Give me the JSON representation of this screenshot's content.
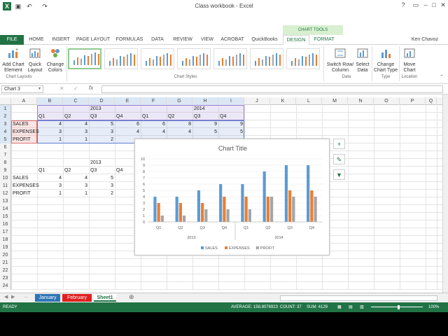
{
  "title_bar": {
    "title": "Class workbook - Excel",
    "chart_tools_label": "CHART TOOLS",
    "qat_icons": [
      "excel-icon",
      "save-icon",
      "undo-icon",
      "redo-icon"
    ]
  },
  "ribbon_tabs": [
    {
      "label": "FILE"
    },
    {
      "label": "HOME"
    },
    {
      "label": "INSERT"
    },
    {
      "label": "PAGE LAYOUT"
    },
    {
      "label": "FORMULAS"
    },
    {
      "label": "DATA"
    },
    {
      "label": "REVIEW"
    },
    {
      "label": "VIEW"
    },
    {
      "label": "ACROBAT"
    },
    {
      "label": "QuickBooks"
    },
    {
      "label": "DESIGN"
    },
    {
      "label": "FORMAT"
    }
  ],
  "user_name": "Ken Chavoz",
  "ribbon": {
    "add_chart_element": "Add Chart Element",
    "quick_layout": "Quick Layout",
    "change_colors": "Change Colors",
    "group_chart_layouts": "Chart Layouts",
    "group_chart_styles": "Chart Styles",
    "switch_row_column": "Switch Row/ Column",
    "select_data": "Select Data",
    "group_data": "Data",
    "change_chart_type": "Change Chart Type",
    "group_type": "Type",
    "move_chart": "Move Chart",
    "group_location": "Location"
  },
  "formula_bar": {
    "name_box": "Chart 3",
    "fx": "fx",
    "value": ""
  },
  "columns": [
    "A",
    "B",
    "C",
    "D",
    "E",
    "F",
    "G",
    "H",
    "I",
    "J",
    "K",
    "L",
    "M",
    "N",
    "O",
    "P",
    "Q"
  ],
  "rows": [
    "1",
    "2",
    "3",
    "4",
    "5",
    "6",
    "7",
    "8",
    "9",
    "10",
    "11",
    "12",
    "13",
    "14",
    "15",
    "16",
    "17",
    "18",
    "19",
    "20",
    "21",
    "22",
    "23",
    "24"
  ],
  "table1": {
    "year1": "2013",
    "year2": "2014",
    "quarters": [
      "Q1",
      "Q2",
      "Q3",
      "Q4",
      "Q1",
      "Q2",
      "Q3",
      "Q4"
    ],
    "rows": [
      {
        "label": "SALES",
        "values": [
          "4",
          "4",
          "5",
          "6",
          "6",
          "8",
          "9",
          "9"
        ]
      },
      {
        "label": "EXPENSES",
        "values": [
          "3",
          "3",
          "3",
          "4",
          "4",
          "4",
          "5",
          "5"
        ]
      },
      {
        "label": "PROFIT",
        "values": [
          "1",
          "1",
          "2",
          "",
          "",
          "",
          "",
          ""
        ]
      }
    ]
  },
  "table2": {
    "year": "2013",
    "quarters": [
      "Q1",
      "Q2",
      "Q3",
      "Q4"
    ],
    "rows": [
      {
        "label": "SALES",
        "values": [
          "4",
          "4",
          "5"
        ]
      },
      {
        "label": "EXPENSES",
        "values": [
          "3",
          "3",
          "3"
        ]
      },
      {
        "label": "PROFIT",
        "values": [
          "1",
          "1",
          "2"
        ]
      }
    ]
  },
  "chart_data": {
    "type": "bar",
    "title": "Chart Title",
    "categories": [
      "Q1",
      "Q2",
      "Q3",
      "Q4",
      "Q1",
      "Q2",
      "Q3",
      "Q4"
    ],
    "groups": [
      "2013",
      "2014"
    ],
    "ylim": [
      0,
      10
    ],
    "y_ticks": [
      "0",
      "1",
      "2",
      "3",
      "4",
      "5",
      "6",
      "7",
      "8",
      "9",
      "10"
    ],
    "series": [
      {
        "name": "SALES",
        "color": "#5b9bd5",
        "values": [
          4,
          4,
          5,
          6,
          6,
          8,
          9,
          9
        ]
      },
      {
        "name": "EXPENSES",
        "color": "#ed7d31",
        "values": [
          3,
          3,
          3,
          4,
          4,
          4,
          5,
          5
        ]
      },
      {
        "name": "PROFIT",
        "color": "#a5a5a5",
        "values": [
          1,
          1,
          2,
          2,
          2,
          4,
          4,
          4
        ]
      }
    ],
    "legend_position": "bottom"
  },
  "chart_side_buttons": [
    "plus-icon",
    "brush-icon",
    "filter-icon"
  ],
  "sheet_tabs": [
    {
      "label": "January",
      "color": "#2e75b6"
    },
    {
      "label": "February",
      "color": "#e02020"
    },
    {
      "label": "Sheet1",
      "color": "#ffffff"
    }
  ],
  "status": {
    "ready": "READY",
    "average": "AVERAGE: 158.8076923",
    "count": "COUNT: 37",
    "sum": "SUM: 4129",
    "zoom": "100%"
  }
}
